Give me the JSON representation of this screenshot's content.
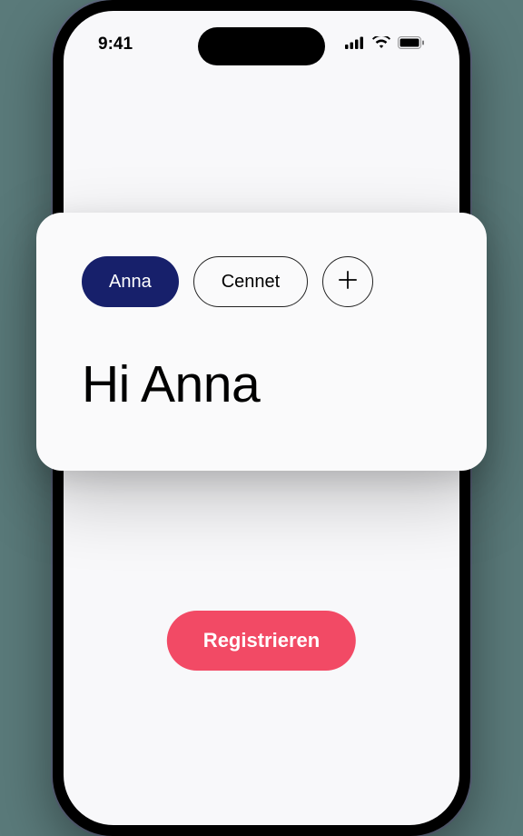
{
  "status_bar": {
    "time": "9:41"
  },
  "card": {
    "chips": [
      {
        "label": "Anna",
        "active": true
      },
      {
        "label": "Cennet",
        "active": false
      }
    ],
    "greeting": "Hi Anna"
  },
  "cta": {
    "register_label": "Registrieren"
  },
  "colors": {
    "accent_primary": "#17206b",
    "accent_cta": "#f24a65",
    "surface": "#f8f8fa",
    "card": "#fafafb"
  }
}
